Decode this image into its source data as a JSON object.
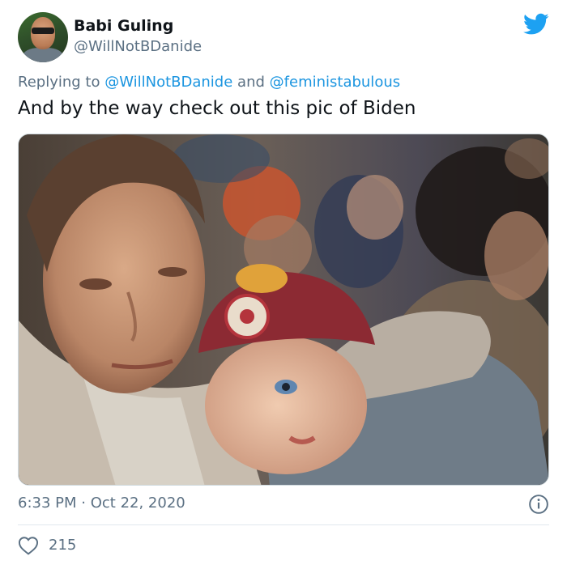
{
  "author": {
    "name": "Babi Guling",
    "handle": "@WillNotBDanide",
    "avatar_icon": "profile-avatar"
  },
  "reply": {
    "prefix": "Replying to",
    "mention_1": "@WillNotBDanide",
    "joiner": "and",
    "mention_2": "@feministabulous"
  },
  "tweet": {
    "text": "And by the way check out this pic of Biden",
    "media_alt_icon": "photo-man-with-child"
  },
  "meta": {
    "time": "6:33 PM",
    "separator": "·",
    "date": "Oct 22, 2020",
    "info_icon": "info-icon"
  },
  "engagement": {
    "like_icon": "heart-icon",
    "like_count": "215"
  },
  "colors": {
    "brand": "#1da1f2",
    "mention": "#1b95e0",
    "muted": "#5b7083",
    "text": "#0f1419",
    "divider": "#e1e8ed"
  }
}
